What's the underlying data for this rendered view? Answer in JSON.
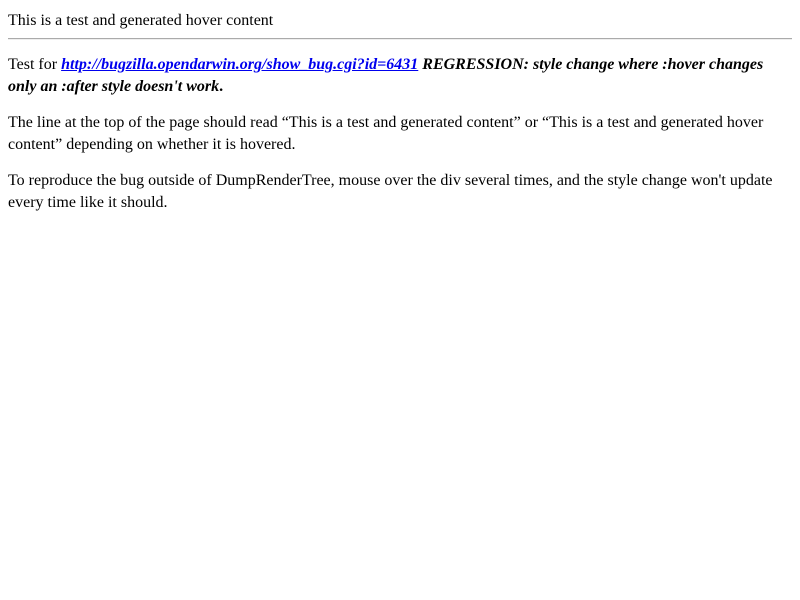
{
  "hover_line": "This is a test and generated hover content",
  "paragraph1": {
    "prefix": "Test for ",
    "link_text": "http://bugzilla.opendarwin.org/show_bug.cgi?id=6431",
    "description": " REGRESSION: style change where :hover changes only an :after style doesn't work",
    "suffix": "."
  },
  "paragraph2": "The line at the top of the page should read “This is a test and generated content” or “This is a test and generated hover content” depending on whether it is hovered.",
  "paragraph3": "To reproduce the bug outside of DumpRenderTree, mouse over the div several times, and the style change won't update every time like it should."
}
